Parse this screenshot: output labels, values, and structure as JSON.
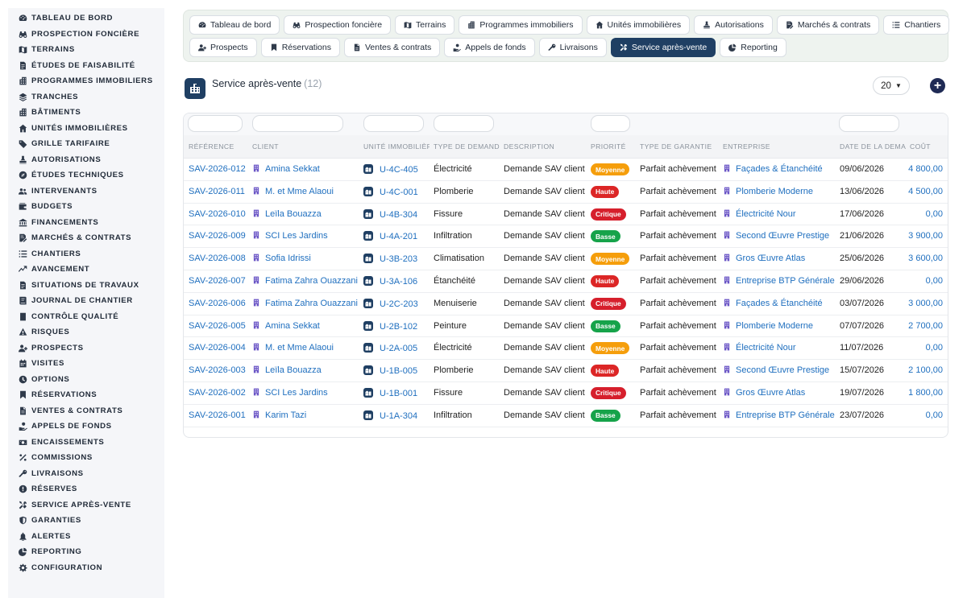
{
  "sidebar": {
    "items": [
      {
        "label": "TABLEAU DE BORD",
        "icon": "dashboard-icon"
      },
      {
        "label": "PROSPECTION FONCIÈRE",
        "icon": "binoculars-icon"
      },
      {
        "label": "TERRAINS",
        "icon": "map-icon"
      },
      {
        "label": "ÉTUDES DE FAISABILITÉ",
        "icon": "document-icon"
      },
      {
        "label": "PROGRAMMES IMMOBILIERS",
        "icon": "building-icon"
      },
      {
        "label": "TRANCHES",
        "icon": "layers-icon"
      },
      {
        "label": "BÂTIMENTS",
        "icon": "building-icon"
      },
      {
        "label": "UNITÉS IMMOBILIÈRES",
        "icon": "home-icon"
      },
      {
        "label": "GRILLE TARIFAIRE",
        "icon": "tag-icon"
      },
      {
        "label": "AUTORISATIONS",
        "icon": "stamp-icon"
      },
      {
        "label": "ÉTUDES TECHNIQUES",
        "icon": "compass-icon"
      },
      {
        "label": "INTERVENANTS",
        "icon": "users-icon"
      },
      {
        "label": "BUDGETS",
        "icon": "wallet-icon"
      },
      {
        "label": "FINANCEMENTS",
        "icon": "bank-icon"
      },
      {
        "label": "MARCHÉS & CONTRATS",
        "icon": "contract-icon"
      },
      {
        "label": "CHANTIERS",
        "icon": "list-icon"
      },
      {
        "label": "AVANCEMENT",
        "icon": "progress-icon"
      },
      {
        "label": "SITUATIONS DE TRAVAUX",
        "icon": "document-icon"
      },
      {
        "label": "JOURNAL DE CHANTIER",
        "icon": "book-icon"
      },
      {
        "label": "CONTRÔLE QUALITÉ",
        "icon": "check-icon"
      },
      {
        "label": "RISQUES",
        "icon": "warning-icon"
      },
      {
        "label": "PROSPECTS",
        "icon": "user-plus-icon"
      },
      {
        "label": "VISITES",
        "icon": "calendar-icon"
      },
      {
        "label": "OPTIONS",
        "icon": "clock-icon"
      },
      {
        "label": "RÉSERVATIONS",
        "icon": "bookmark-icon"
      },
      {
        "label": "VENTES & CONTRATS",
        "icon": "file-icon"
      },
      {
        "label": "APPELS DE FONDS",
        "icon": "hand-coin-icon"
      },
      {
        "label": "ENCAISSEMENTS",
        "icon": "cash-icon"
      },
      {
        "label": "COMMISSIONS",
        "icon": "percent-icon"
      },
      {
        "label": "LIVRAISONS",
        "icon": "key-icon"
      },
      {
        "label": "RÉSERVES",
        "icon": "alert-circle-icon"
      },
      {
        "label": "SERVICE APRÈS-VENTE",
        "icon": "tools-icon"
      },
      {
        "label": "GARANTIES",
        "icon": "shield-icon"
      },
      {
        "label": "ALERTES",
        "icon": "bell-icon"
      },
      {
        "label": "REPORTING",
        "icon": "pie-icon"
      },
      {
        "label": "CONFIGURATION",
        "icon": "gear-icon"
      }
    ]
  },
  "tabs": {
    "row1": [
      {
        "label": "Tableau de bord",
        "icon": "dashboard-icon"
      },
      {
        "label": "Prospection foncière",
        "icon": "binoculars-icon"
      },
      {
        "label": "Terrains",
        "icon": "map-icon"
      },
      {
        "label": "Programmes immobiliers",
        "icon": "building-icon"
      },
      {
        "label": "Unités immobilières",
        "icon": "home-icon"
      },
      {
        "label": "Autorisations",
        "icon": "stamp-icon"
      },
      {
        "label": "Marchés & contrats",
        "icon": "contract-icon"
      },
      {
        "label": "Chantiers",
        "icon": "list-icon"
      }
    ],
    "row2": [
      {
        "label": "Prospects",
        "icon": "user-plus-icon"
      },
      {
        "label": "Réservations",
        "icon": "bookmark-icon"
      },
      {
        "label": "Ventes & contrats",
        "icon": "file-icon"
      },
      {
        "label": "Appels de fonds",
        "icon": "hand-coin-icon"
      },
      {
        "label": "Livraisons",
        "icon": "key-icon"
      },
      {
        "label": "Service après-vente",
        "icon": "tools-icon",
        "active": true
      },
      {
        "label": "Reporting",
        "icon": "pie-icon"
      }
    ]
  },
  "header": {
    "title": "Service après-vente",
    "count": "(12)",
    "page_size": "20",
    "add_label": "+"
  },
  "table": {
    "columns": [
      "RÉFÉRENCE",
      "CLIENT",
      "UNITÉ IMMOBILIÈRE",
      "TYPE DE DEMANDE",
      "DESCRIPTION",
      "PRIORITÉ",
      "TYPE DE GARANTIE",
      "ENTREPRISE",
      "DATE DE LA DEMANDE",
      "COÛT"
    ],
    "rows": [
      {
        "ref": "SAV-2026-012",
        "client": "Amina Sekkat",
        "unit": "U-4C-405",
        "type": "Électricité",
        "desc": "Demande SAV client",
        "priority": "Moyenne",
        "guarantee": "Parfait achèvement",
        "company": "Façades & Étanchéité",
        "date": "09/06/2026",
        "cost": "4 800,00"
      },
      {
        "ref": "SAV-2026-011",
        "client": "M. et Mme Alaoui",
        "unit": "U-4C-001",
        "type": "Plomberie",
        "desc": "Demande SAV client",
        "priority": "Haute",
        "guarantee": "Parfait achèvement",
        "company": "Plomberie Moderne",
        "date": "13/06/2026",
        "cost": "4 500,00"
      },
      {
        "ref": "SAV-2026-010",
        "client": "Leïla Bouazza",
        "unit": "U-4B-304",
        "type": "Fissure",
        "desc": "Demande SAV client",
        "priority": "Critique",
        "guarantee": "Parfait achèvement",
        "company": "Électricité Nour",
        "date": "17/06/2026",
        "cost": "0,00"
      },
      {
        "ref": "SAV-2026-009",
        "client": "SCI Les Jardins",
        "unit": "U-4A-201",
        "type": "Infiltration",
        "desc": "Demande SAV client",
        "priority": "Basse",
        "guarantee": "Parfait achèvement",
        "company": "Second Œuvre Prestige",
        "date": "21/06/2026",
        "cost": "3 900,00"
      },
      {
        "ref": "SAV-2026-008",
        "client": "Sofia Idrissi",
        "unit": "U-3B-203",
        "type": "Climatisation",
        "desc": "Demande SAV client",
        "priority": "Moyenne",
        "guarantee": "Parfait achèvement",
        "company": "Gros Œuvre Atlas",
        "date": "25/06/2026",
        "cost": "3 600,00"
      },
      {
        "ref": "SAV-2026-007",
        "client": "Fatima Zahra Ouazzani",
        "unit": "U-3A-106",
        "type": "Étanchéité",
        "desc": "Demande SAV client",
        "priority": "Haute",
        "guarantee": "Parfait achèvement",
        "company": "Entreprise BTP Générale",
        "date": "29/06/2026",
        "cost": "0,00"
      },
      {
        "ref": "SAV-2026-006",
        "client": "Fatima Zahra Ouazzani",
        "unit": "U-2C-203",
        "type": "Menuiserie",
        "desc": "Demande SAV client",
        "priority": "Critique",
        "guarantee": "Parfait achèvement",
        "company": "Façades & Étanchéité",
        "date": "03/07/2026",
        "cost": "3 000,00"
      },
      {
        "ref": "SAV-2026-005",
        "client": "Amina Sekkat",
        "unit": "U-2B-102",
        "type": "Peinture",
        "desc": "Demande SAV client",
        "priority": "Basse",
        "guarantee": "Parfait achèvement",
        "company": "Plomberie Moderne",
        "date": "07/07/2026",
        "cost": "2 700,00"
      },
      {
        "ref": "SAV-2026-004",
        "client": "M. et Mme Alaoui",
        "unit": "U-2A-005",
        "type": "Électricité",
        "desc": "Demande SAV client",
        "priority": "Moyenne",
        "guarantee": "Parfait achèvement",
        "company": "Électricité Nour",
        "date": "11/07/2026",
        "cost": "0,00"
      },
      {
        "ref": "SAV-2026-003",
        "client": "Leïla Bouazza",
        "unit": "U-1B-005",
        "type": "Plomberie",
        "desc": "Demande SAV client",
        "priority": "Haute",
        "guarantee": "Parfait achèvement",
        "company": "Second Œuvre Prestige",
        "date": "15/07/2026",
        "cost": "2 100,00"
      },
      {
        "ref": "SAV-2026-002",
        "client": "SCI Les Jardins",
        "unit": "U-1B-001",
        "type": "Fissure",
        "desc": "Demande SAV client",
        "priority": "Critique",
        "guarantee": "Parfait achèvement",
        "company": "Gros Œuvre Atlas",
        "date": "19/07/2026",
        "cost": "1 800,00"
      },
      {
        "ref": "SAV-2026-001",
        "client": "Karim Tazi",
        "unit": "U-1A-304",
        "type": "Infiltration",
        "desc": "Demande SAV client",
        "priority": "Basse",
        "guarantee": "Parfait achèvement",
        "company": "Entreprise BTP Générale",
        "date": "23/07/2026",
        "cost": "0,00"
      }
    ]
  },
  "colors": {
    "accent": "#1f3f63",
    "link": "#1f6fbf",
    "priority_moyenne": "#f59e0b",
    "priority_haute": "#dc2626",
    "priority_critique": "#d61f2c",
    "priority_basse": "#16a34a"
  }
}
